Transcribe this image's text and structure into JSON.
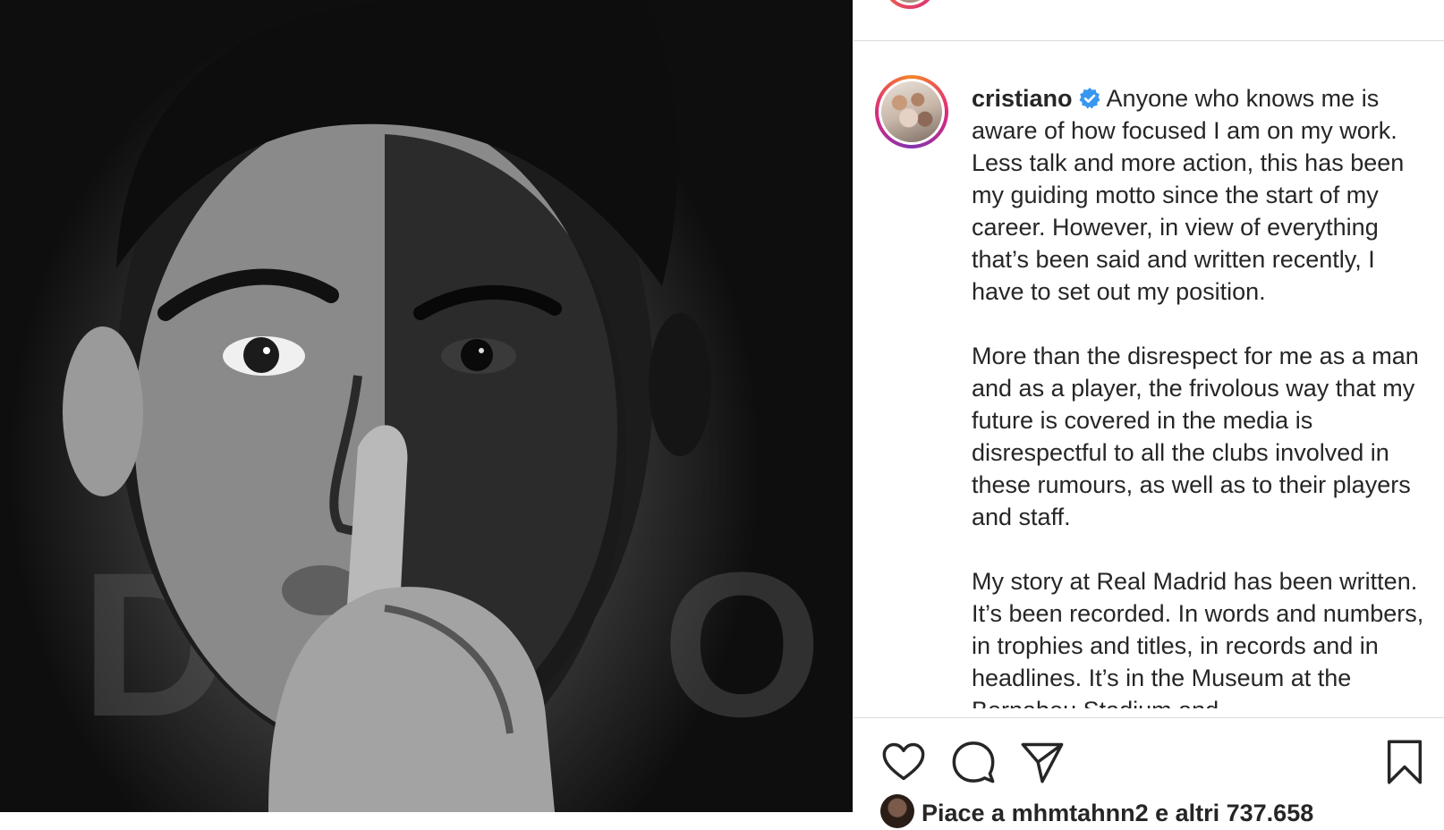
{
  "post": {
    "username": "cristiano",
    "verified": true,
    "caption_paragraphs": [
      "Anyone who knows me is aware of how focused I am on my work. Less talk and more action, this has been my guiding motto since the start of my career. However, in view of everything that’s been said and written recently, I have to set out my position.",
      "More than the disrespect for me as a man and as a player, the frivolous way that my future is covered in the media is disrespectful to all the clubs involved in these rumours, as well as to their players and staff.",
      "My story at Real Madrid has been written. It’s been recorded. In words and numbers, in trophies and titles, in records and in headlines. It’s in the Museum at the Bernabeu Stadium and"
    ],
    "likes_text": "Piace a mhmtahnn2 e altri 737.658"
  },
  "icons": {
    "like": "heart-icon",
    "comment": "comment-icon",
    "share": "paper-plane-icon",
    "save": "bookmark-icon",
    "verified": "verified-badge-icon"
  },
  "colors": {
    "text": "#262626",
    "verified": "#3897f0",
    "border": "#dbdbdb"
  }
}
